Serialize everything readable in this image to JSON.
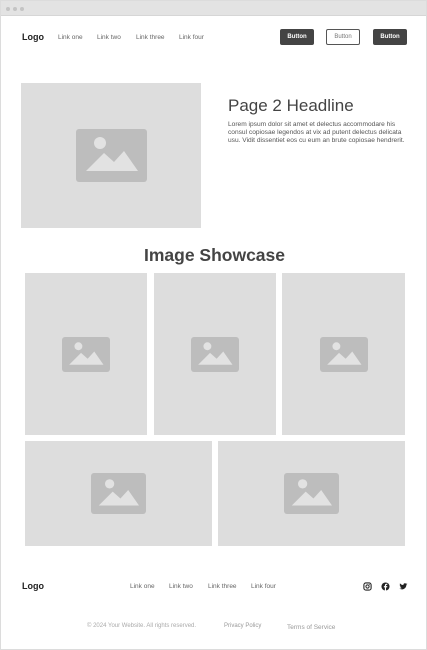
{
  "header": {
    "logo": "Logo",
    "nav": [
      "Link one",
      "Link two",
      "Link three",
      "Link four"
    ],
    "buttons": [
      "Button",
      "Button",
      "Button"
    ]
  },
  "hero": {
    "headline": "Page 2 Headline",
    "body": "Lorem ipsum dolor sit amet et delectus accommodare his consul copiosae legendos at vix ad putent delectus delicata usu. Vidit dissentiet eos cu eum an brute copiosae hendrerit."
  },
  "showcase": {
    "title": "Image Showcase"
  },
  "footer": {
    "logo": "Logo",
    "nav": [
      "Link one",
      "Link two",
      "Link three",
      "Link four"
    ],
    "social_icons": [
      "instagram-icon",
      "facebook-icon",
      "twitter-icon"
    ],
    "copyright": "© 2024 Your Website. All rights reserved.",
    "privacy": "Privacy Policy",
    "terms": "Terms of Service"
  },
  "colors": {
    "placeholder_bg": "#dddddd",
    "placeholder_icon": "#bdbdbd",
    "button_dark": "#444444"
  }
}
